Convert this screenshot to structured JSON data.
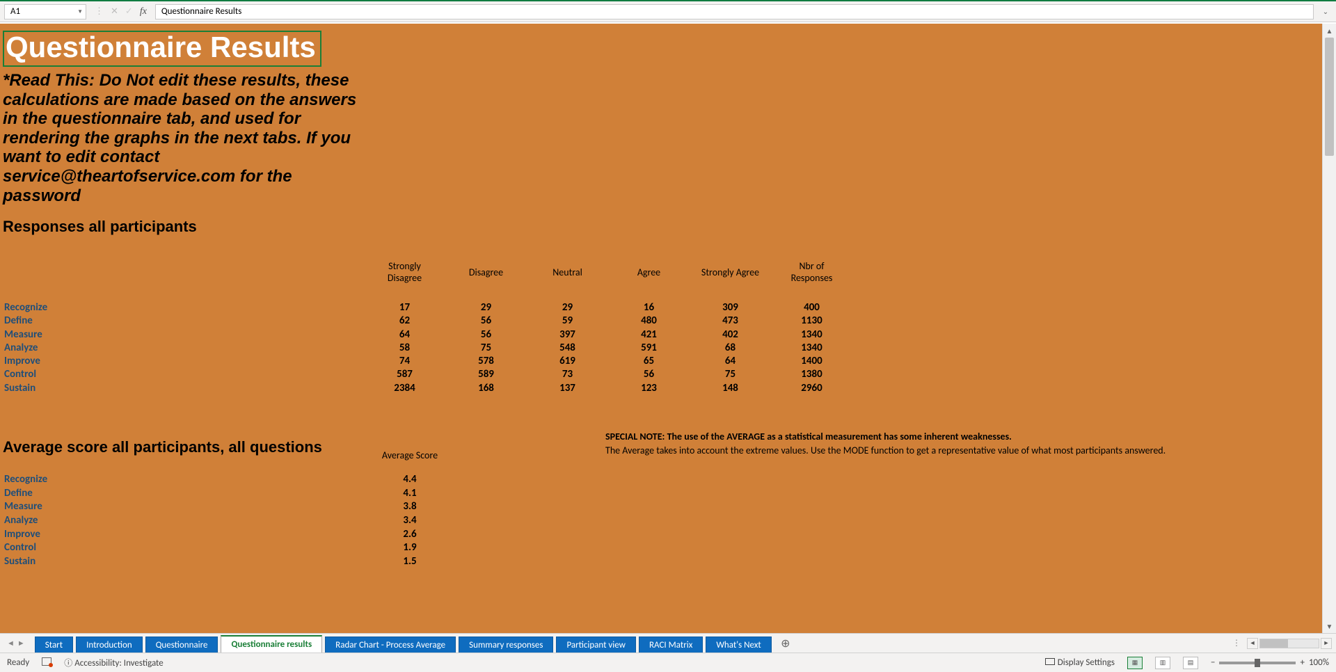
{
  "cell_ref": "A1",
  "formula_value": "Questionnaire Results",
  "title": "Questionnaire Results",
  "warning": "*Read This: Do Not edit these results, these calculations are made based on the answers in the questionnaire tab, and used for rendering the graphs in the next tabs. If you want to edit contact service@theartofservice.com for the password",
  "section1_heading": "Responses all participants",
  "section2_heading": "Average score all participants, all questions",
  "col_headers": {
    "sd1": "Strongly",
    "sd2": "Disagree",
    "d": "Disagree",
    "n": "Neutral",
    "a": "Agree",
    "sa": "Strongly Agree",
    "nr1": "Nbr of",
    "nr2": "Responses",
    "avg": "Average Score"
  },
  "rows": [
    {
      "label": "Recognize",
      "sd": "17",
      "d": "29",
      "n": "29",
      "a": "16",
      "sa": "309",
      "nr": "400",
      "avg": "4.4"
    },
    {
      "label": "Define",
      "sd": "62",
      "d": "56",
      "n": "59",
      "a": "480",
      "sa": "473",
      "nr": "1130",
      "avg": "4.1"
    },
    {
      "label": "Measure",
      "sd": "64",
      "d": "56",
      "n": "397",
      "a": "421",
      "sa": "402",
      "nr": "1340",
      "avg": "3.8"
    },
    {
      "label": "Analyze",
      "sd": "58",
      "d": "75",
      "n": "548",
      "a": "591",
      "sa": "68",
      "nr": "1340",
      "avg": "3.4"
    },
    {
      "label": "Improve",
      "sd": "74",
      "d": "578",
      "n": "619",
      "a": "65",
      "sa": "64",
      "nr": "1400",
      "avg": "2.6"
    },
    {
      "label": "Control",
      "sd": "587",
      "d": "589",
      "n": "73",
      "a": "56",
      "sa": "75",
      "nr": "1380",
      "avg": "1.9"
    },
    {
      "label": "Sustain",
      "sd": "2384",
      "d": "168",
      "n": "137",
      "a": "123",
      "sa": "148",
      "nr": "2960",
      "avg": "1.5"
    }
  ],
  "note1": "SPECIAL NOTE: The use of the AVERAGE as a statistical measurement has some inherent weaknesses.",
  "note2": "The Average takes into account the extreme values. Use the MODE function to get a representative value of what most participants answered.",
  "tabs": [
    "Start",
    "Introduction",
    "Questionnaire",
    "Questionnaire results",
    "Radar Chart - Process Average",
    "Summary responses",
    "Participant view",
    "RACI Matrix",
    "What's Next"
  ],
  "active_tab_index": 3,
  "status": {
    "ready": "Ready",
    "accessibility": "Accessibility: Investigate",
    "display_settings": "Display Settings",
    "zoom": "100%"
  }
}
